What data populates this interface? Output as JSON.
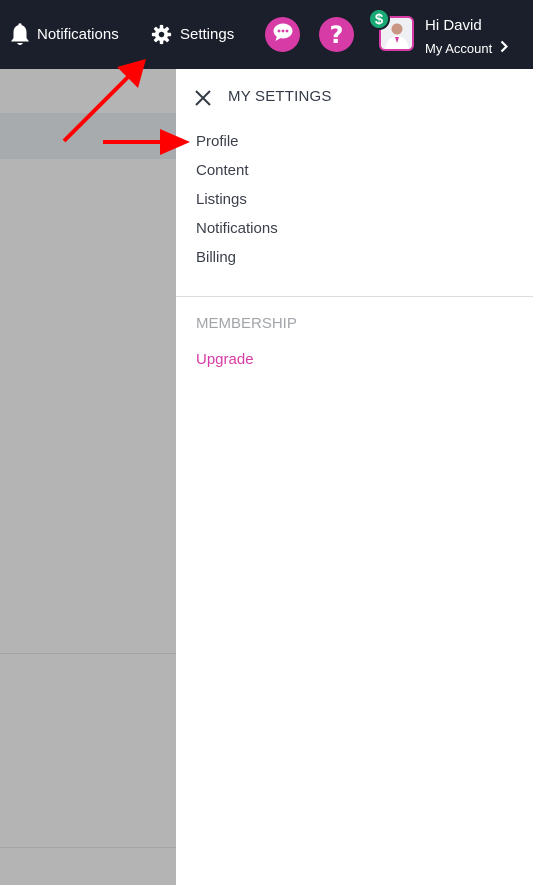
{
  "header": {
    "notifications_label": "Notifications",
    "settings_label": "Settings",
    "greeting": "Hi David",
    "account_label": "My Account",
    "help_glyph": "?",
    "balance_glyph": "$",
    "icons": [
      "bell-icon",
      "gear-icon",
      "chat-bubble-icon",
      "help-icon",
      "dollar-badge-icon",
      "chevron-right-icon"
    ]
  },
  "settings_panel": {
    "title": "MY SETTINGS",
    "menu": [
      {
        "label": "Profile"
      },
      {
        "label": "Content"
      },
      {
        "label": "Listings"
      },
      {
        "label": "Notifications"
      },
      {
        "label": "Billing"
      }
    ],
    "membership": {
      "section_label": "MEMBERSHIP",
      "upgrade_label": "Upgrade"
    }
  },
  "colors": {
    "topbar": "#1b1f2b",
    "accent_pink": "#d63ba6",
    "badge_green": "#19a974",
    "annotation_red": "#ff0000",
    "overlay_gray": "#b4b4b4"
  }
}
